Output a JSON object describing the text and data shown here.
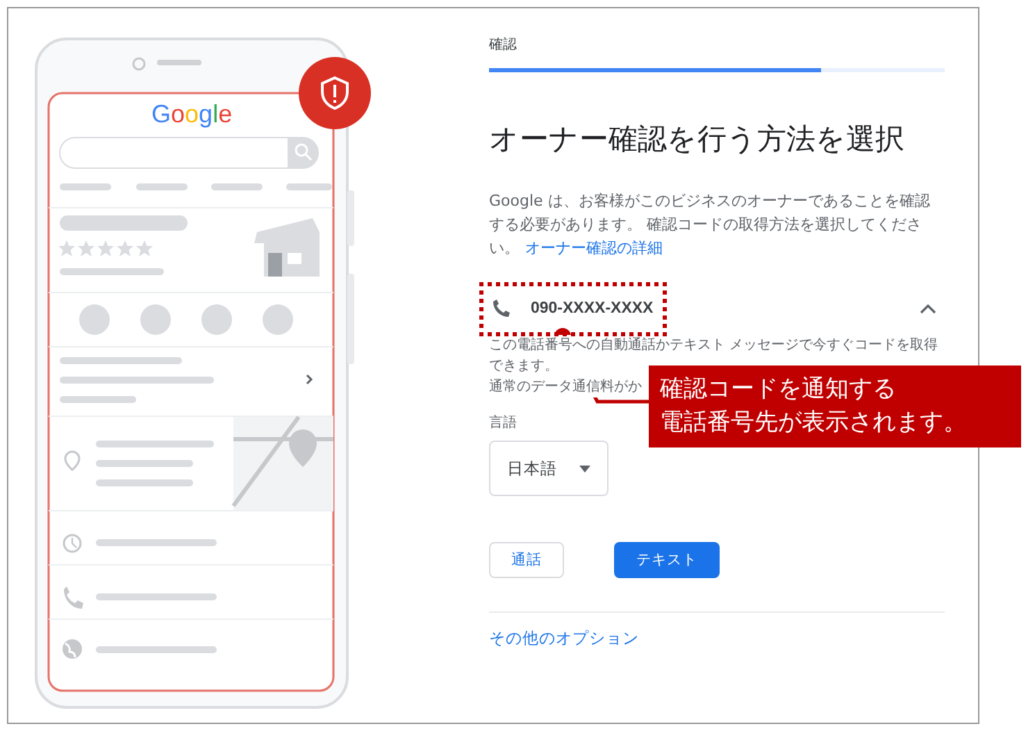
{
  "phone": {
    "logo": "Google"
  },
  "step": {
    "label": "確認",
    "level": 0.73
  },
  "heading": "オーナー確認を行う方法を選択",
  "intro": {
    "text": "Google は、お客様がこのビジネスのオーナーであることを確認する必要があります。 確認コードの取得方法を選択してください。",
    "link": "オーナー確認の詳細"
  },
  "phone_option": {
    "number": "090-XXXX-XXXX",
    "expanded": true,
    "description": "この電話番号への自動通話かテキスト メッセージで今すぐコードを取得できます。",
    "note": "通常のデータ通信料がか"
  },
  "language": {
    "label": "言語",
    "value": "日本語"
  },
  "buttons": [
    {
      "label": "通話",
      "kind": "outlined"
    },
    {
      "label": "テキスト",
      "kind": "filled"
    }
  ],
  "more_link": "その他のオプション",
  "callout": {
    "lines": [
      "確認コードを通知する",
      "電話番号先が表示されます。"
    ]
  }
}
